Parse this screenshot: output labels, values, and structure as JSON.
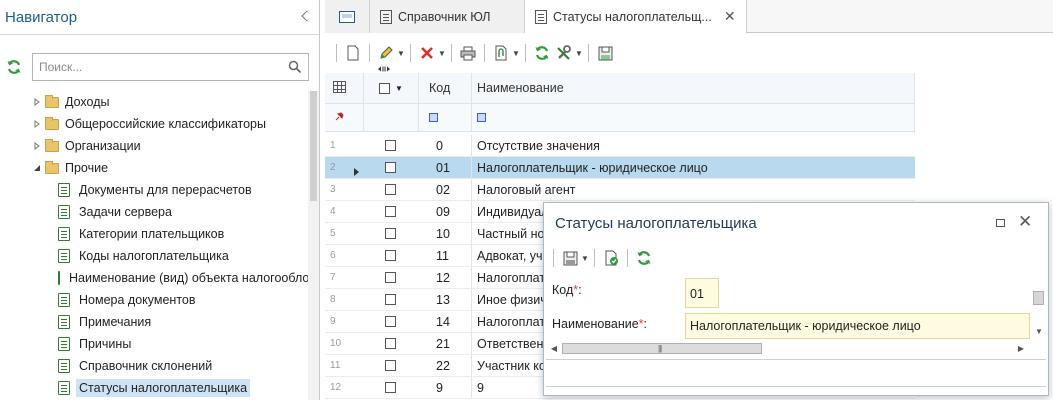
{
  "navigator": {
    "title": "Навигатор",
    "search_placeholder": "Поиск...",
    "tree": [
      {
        "label": "Доходы",
        "type": "folder",
        "expanded": false
      },
      {
        "label": "Общероссийские классификаторы",
        "type": "folder",
        "expanded": false
      },
      {
        "label": "Организации",
        "type": "folder",
        "expanded": false
      },
      {
        "label": "Прочие",
        "type": "folder",
        "expanded": true
      },
      {
        "label": "Документы для перерасчетов",
        "type": "doc"
      },
      {
        "label": "Задачи сервера",
        "type": "doc"
      },
      {
        "label": "Категории плательщиков",
        "type": "doc"
      },
      {
        "label": "Коды налогоплательщика",
        "type": "doc"
      },
      {
        "label": "Наименование (вид) объекта налогообложения",
        "type": "doc"
      },
      {
        "label": "Номера документов",
        "type": "doc"
      },
      {
        "label": "Примечания",
        "type": "doc"
      },
      {
        "label": "Причины",
        "type": "doc"
      },
      {
        "label": "Справочник склонений",
        "type": "doc"
      },
      {
        "label": "Статусы налогоплательщика",
        "type": "doc",
        "selected": true
      }
    ]
  },
  "tabs": [
    {
      "label": "Справочник ЮЛ"
    },
    {
      "label": "Статусы налогоплательщ...",
      "active": true,
      "close": "✕"
    }
  ],
  "grid": {
    "columns": {
      "code": "Код",
      "name": "Наименование"
    },
    "rows": [
      {
        "num": "1",
        "code": "0",
        "name": "Отсутствие значения"
      },
      {
        "num": "2",
        "code": "01",
        "name": "Налогоплательщик - юридическое лицо",
        "selected": true
      },
      {
        "num": "3",
        "code": "02",
        "name": "Налоговый агент"
      },
      {
        "num": "4",
        "code": "09",
        "name": "Индивидуальный предприниматель"
      },
      {
        "num": "5",
        "code": "10",
        "name": "Частный нотариус"
      },
      {
        "num": "6",
        "code": "11",
        "name": "Адвокат, учредивший адвокатский кабинет"
      },
      {
        "num": "7",
        "code": "12",
        "name": "Налогоплательщик - физическое лицо"
      },
      {
        "num": "8",
        "code": "13",
        "name": "Иное физическое лицо"
      },
      {
        "num": "9",
        "code": "14",
        "name": "Налогоплательщик, производящий выплаты"
      },
      {
        "num": "10",
        "code": "21",
        "name": "Ответственный участник консолидированной группы"
      },
      {
        "num": "11",
        "code": "22",
        "name": "Участник консолидированной группы"
      },
      {
        "num": "12",
        "code": "9",
        "name": "9"
      }
    ]
  },
  "dialog": {
    "title": "Статусы налогоплательщика",
    "code_label": "Код",
    "name_label": "Наименование",
    "required_mark": "*",
    "colon": ":",
    "code_value": "01",
    "name_value": "Налогоплательщик - юридическое лицо"
  },
  "colors": {
    "accent": "#1a5d96",
    "selection": "#b9d9ee",
    "required_field_bg": "#fffbe0",
    "required_mark": "#e03c31",
    "refresh_green": "#2e9c3a",
    "delete_red": "#d9302c"
  },
  "icons": {
    "toolbar": [
      "new-document-icon",
      "edit-pencil-icon",
      "delete-x-icon",
      "print-icon",
      "attach-document-icon",
      "refresh-icon",
      "tools-icon",
      "save-icon"
    ],
    "dialog_toolbar": [
      "save-icon",
      "approve-document-icon",
      "refresh-icon"
    ]
  }
}
